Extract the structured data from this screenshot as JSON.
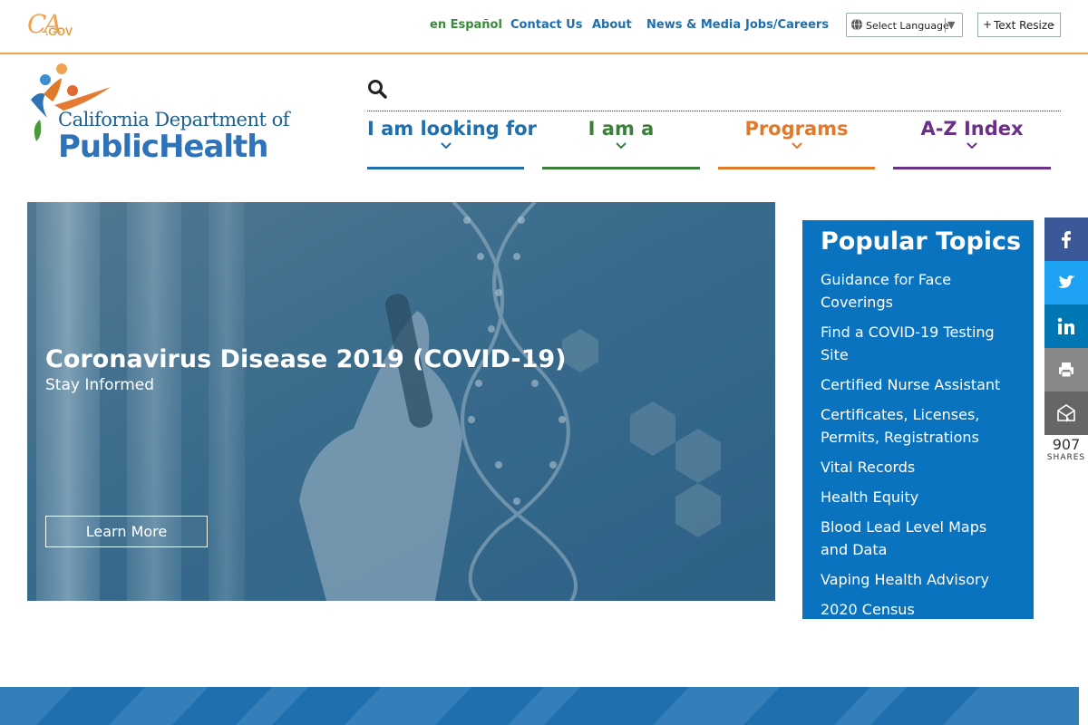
{
  "utility": {
    "ca_logo": "CA",
    "ca_logo_suffix": ".GOV",
    "links": [
      {
        "label": "en Español"
      },
      {
        "label": "Contact Us"
      },
      {
        "label": "About"
      },
      {
        "label": "News & Media"
      },
      {
        "label": "Jobs/Careers"
      }
    ],
    "language": {
      "label": "Select Language",
      "arrow": "▼"
    },
    "text_resize": {
      "plus": "+",
      "label": "Text Resize",
      "minus": "-"
    }
  },
  "logo": {
    "line1": "California Department of",
    "line2a": "Public",
    "line2b": "Health"
  },
  "search": {
    "placeholder": "",
    "value": ""
  },
  "nav": [
    {
      "label": "I am looking for",
      "color": "#1f6fae"
    },
    {
      "label": "I am a",
      "color": "#3a7f3a"
    },
    {
      "label": "Programs",
      "color": "#e07a2a"
    },
    {
      "label": "A-Z Index",
      "color": "#6b2f8a"
    }
  ],
  "hero": {
    "title": "Coronavirus Disease 2019 (COVID-19)",
    "subtitle": "Stay Informed",
    "button": "Learn More"
  },
  "popular": {
    "heading": "Popular Topics",
    "items": [
      "Guidance for Face Coverings",
      "Find a COVID-19 Testing Site",
      "Certified Nurse Assistant",
      "Certificates, Licenses, Permits, Registrations",
      "Vital Records",
      "Health Equity",
      "Blood Lead Level Maps and Data",
      "Vaping Health Advisory",
      "2020 Census"
    ]
  },
  "share": {
    "buttons": [
      {
        "icon": "facebook-icon",
        "color": "#3b5998"
      },
      {
        "icon": "twitter-icon",
        "color": "#1da1f2"
      },
      {
        "icon": "linkedin-icon",
        "color": "#0077b5"
      },
      {
        "icon": "print-icon",
        "color": "#888888"
      },
      {
        "icon": "email-icon",
        "color": "#666666"
      }
    ],
    "count": "907",
    "label": "SHARES"
  }
}
